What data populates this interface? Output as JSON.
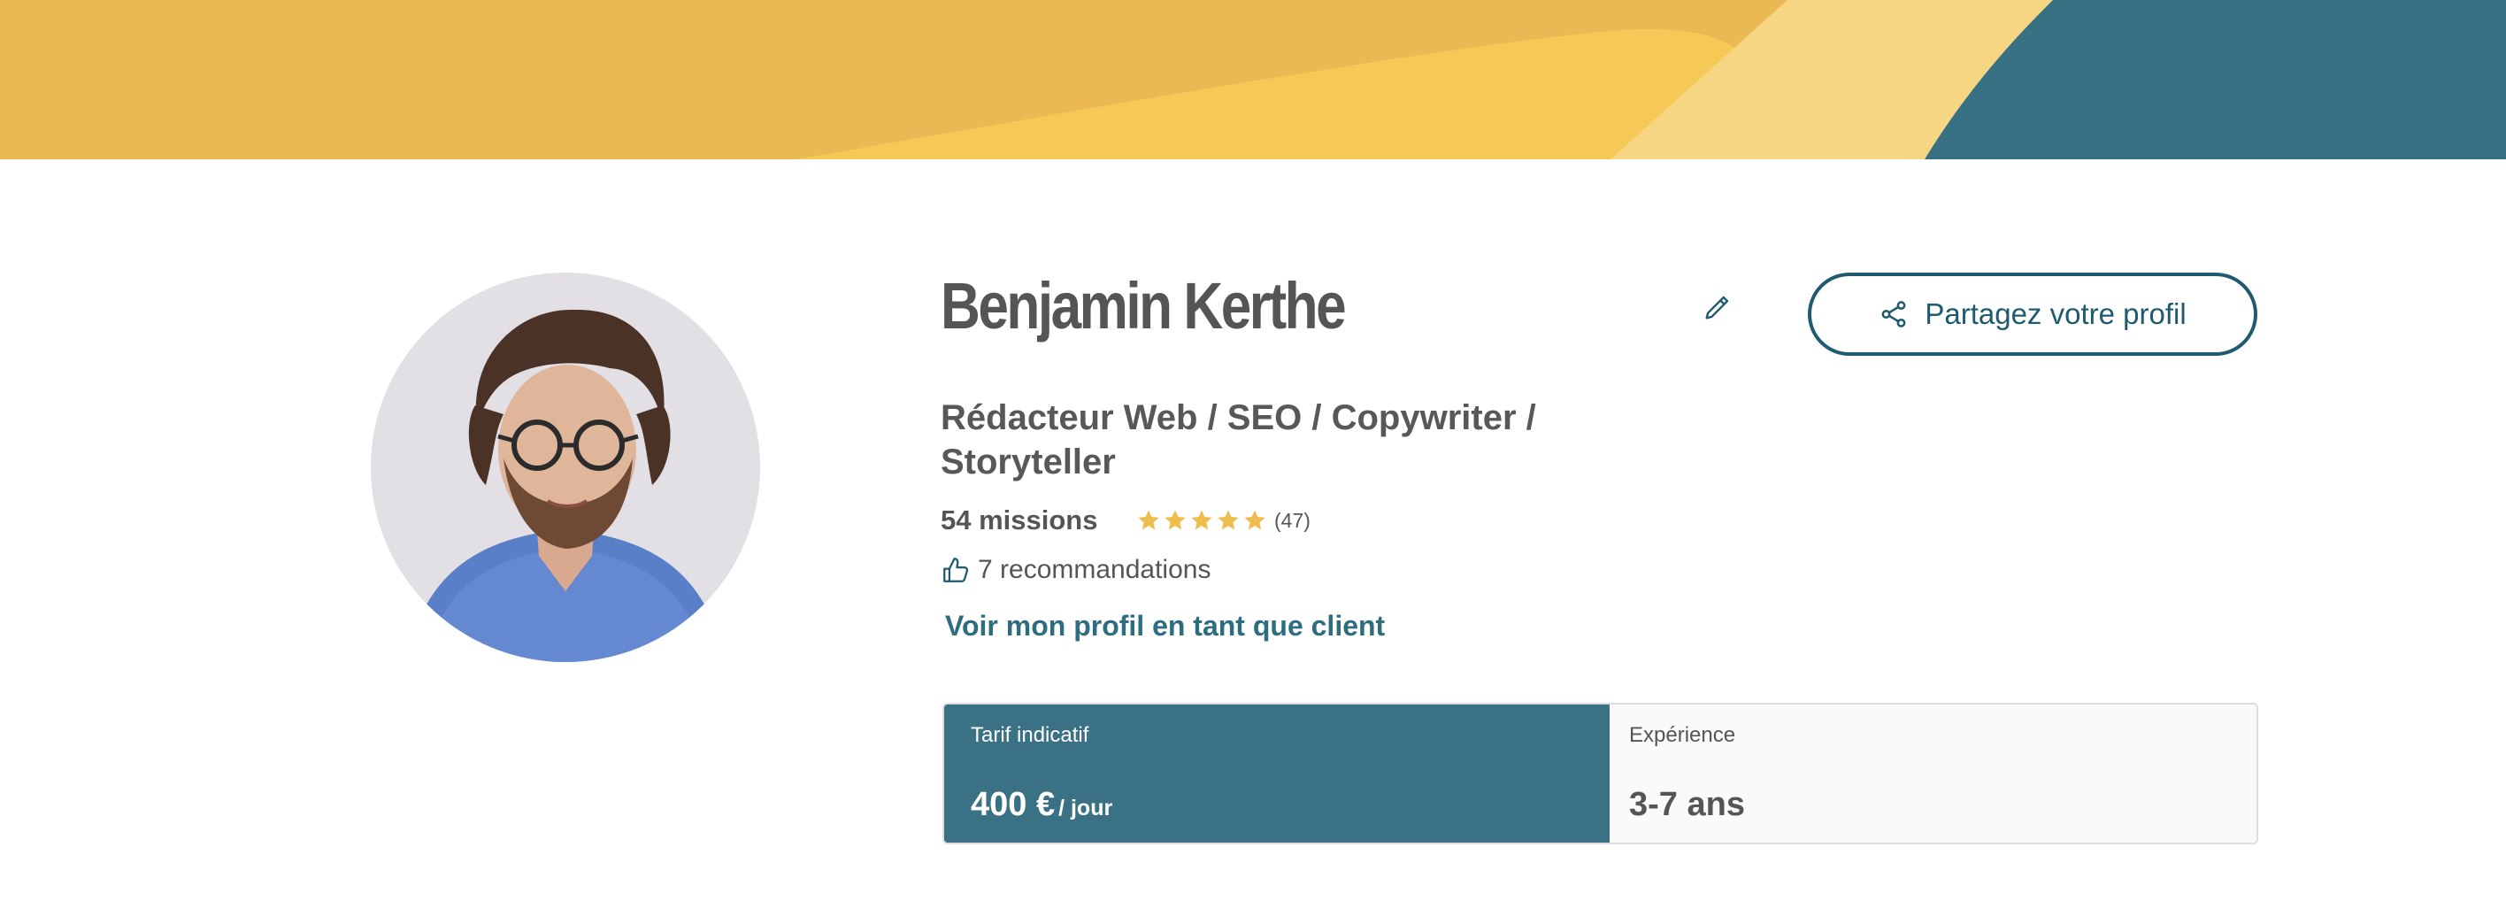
{
  "profile": {
    "name": "Benjamin Kerthe",
    "job_title": "Rédacteur Web / SEO / Copywriter / Storyteller",
    "missions": "54 missions",
    "rating": {
      "stars": 5,
      "max_stars": 5,
      "count": "(47)"
    },
    "recommendations": "7 recommandations",
    "client_view_link": "Voir mon profil en tant que client"
  },
  "actions": {
    "share_label": "Partagez votre profil",
    "edit_icon": "pencil-icon",
    "share_icon": "share-icon"
  },
  "rate": {
    "label": "Tarif indicatif",
    "amount": "400 €",
    "unit": "/ jour"
  },
  "experience": {
    "label": "Expérience",
    "value": "3-7 ans"
  },
  "colors": {
    "brand_teal": "#3a7185",
    "link_teal": "#2e6c80",
    "banner_yellow": "#ecbb55",
    "star_gold": "#eebd4e",
    "text_gray": "#555555"
  }
}
